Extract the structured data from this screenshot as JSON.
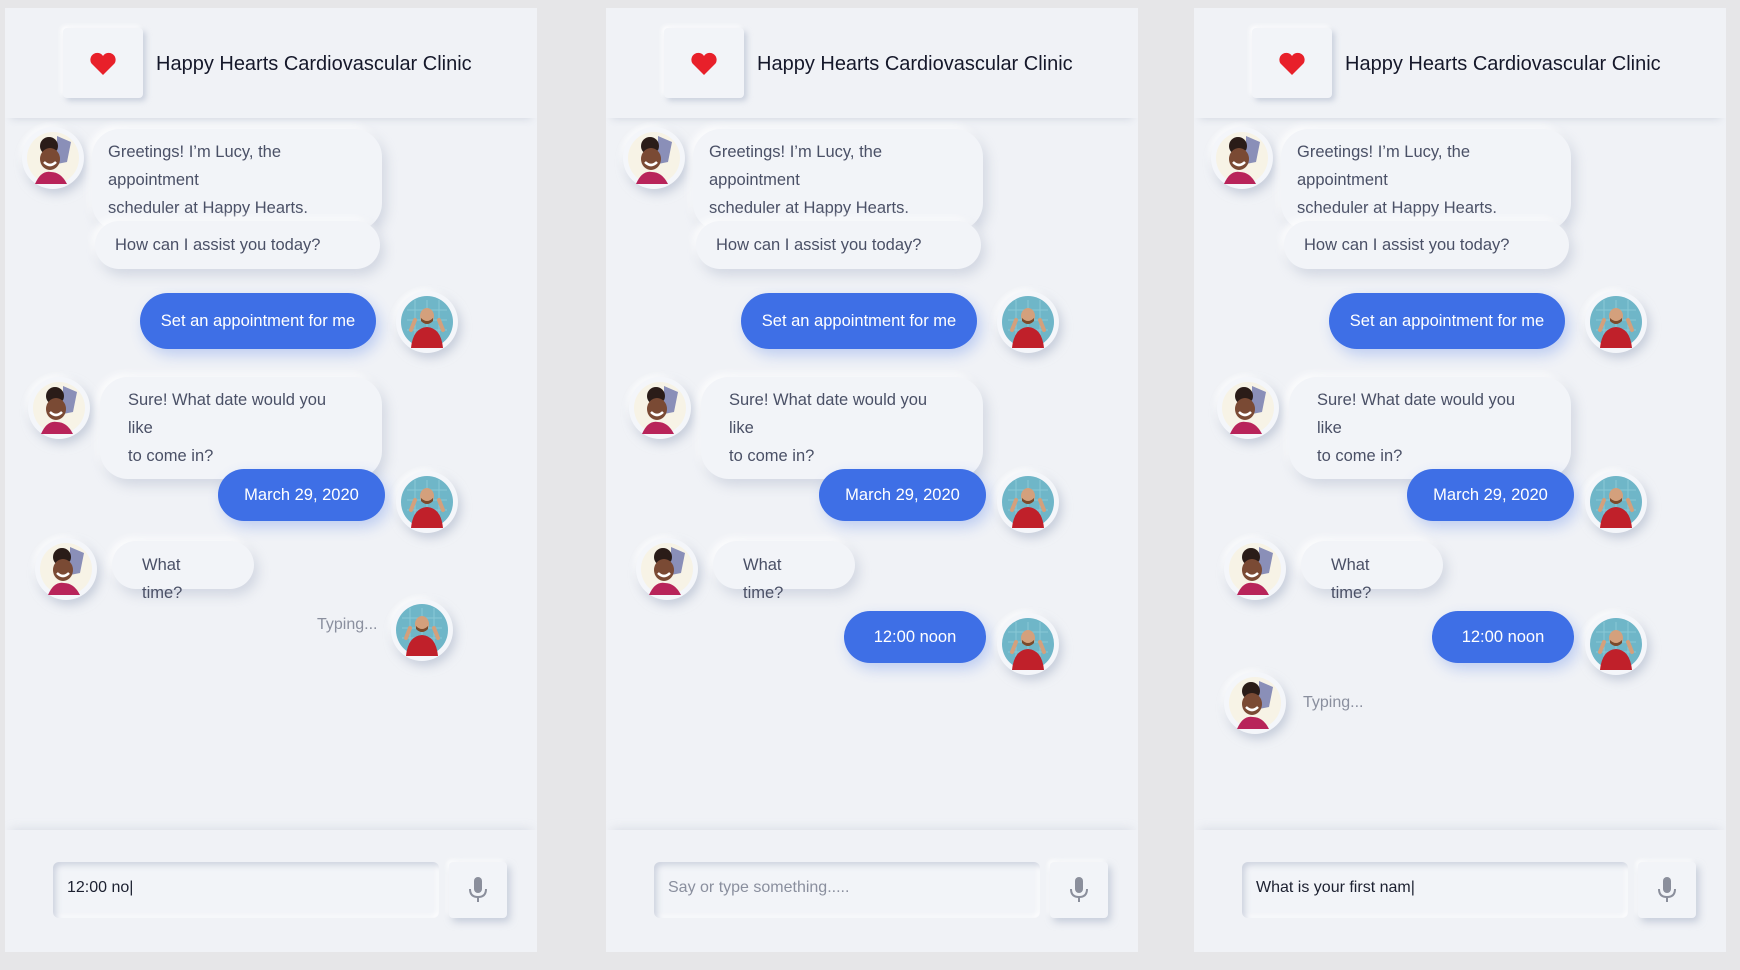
{
  "clinic_name": "Happy Hearts Cardiovascular Clinic",
  "colors": {
    "accent": "#3e6fe6",
    "heart": "#e8202a",
    "panel": "#f0f2f6"
  },
  "icons": {
    "logo": "heart-icon",
    "mic": "microphone-icon"
  },
  "panels": [
    {
      "messages": [
        {
          "text_l1": "Greetings! I’m Lucy, the appointment",
          "text_l2": "scheduler at Happy Hearts."
        },
        {
          "text_l1": "How can I assist you today?"
        },
        {
          "text_l1": "Set an appointment for me"
        },
        {
          "text_l1": "Sure! What date would you like",
          "text_l2": "to come in?"
        },
        {
          "text_l1": "March 29, 2020"
        },
        {
          "text_l1": "What time?"
        }
      ],
      "typing": "Typing...",
      "input_value": "12:00 no|"
    },
    {
      "messages": [
        {
          "text_l1": "Greetings! I’m Lucy, the appointment",
          "text_l2": "scheduler at Happy Hearts."
        },
        {
          "text_l1": "How can I assist you today?"
        },
        {
          "text_l1": "Set an appointment for me"
        },
        {
          "text_l1": "Sure! What date would you like",
          "text_l2": "to come in?"
        },
        {
          "text_l1": "March 29, 2020"
        },
        {
          "text_l1": "What time?"
        },
        {
          "text_l1": "12:00 noon"
        }
      ],
      "input_placeholder": "Say or type something....."
    },
    {
      "messages": [
        {
          "text_l1": "Greetings! I’m Lucy, the appointment",
          "text_l2": "scheduler at Happy Hearts."
        },
        {
          "text_l1": "How can I assist you today?"
        },
        {
          "text_l1": "Set an appointment for me"
        },
        {
          "text_l1": "Sure! What date would you like",
          "text_l2": "to come in?"
        },
        {
          "text_l1": "March 29, 2020"
        },
        {
          "text_l1": "What time?"
        },
        {
          "text_l1": "12:00 noon"
        }
      ],
      "typing": "Typing...",
      "input_value": "What is your first nam|"
    }
  ]
}
